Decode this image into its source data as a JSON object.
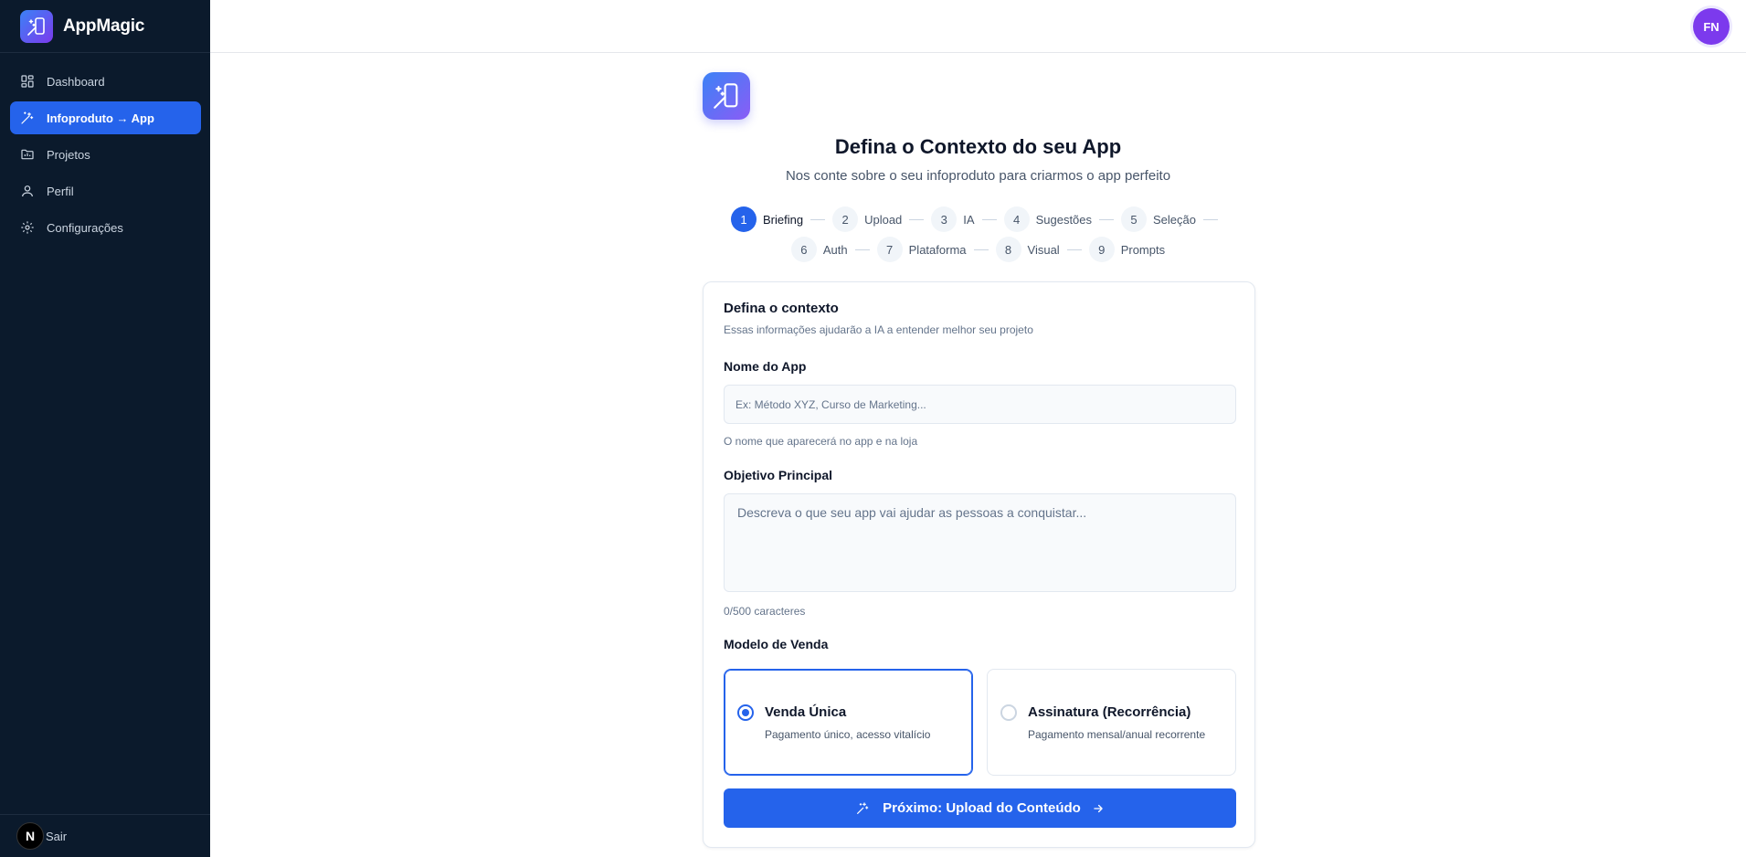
{
  "brand": {
    "name": "AppMagic",
    "logo_icon": "wand-phone-icon"
  },
  "sidebar": {
    "items": [
      {
        "label": "Dashboard",
        "icon": "grid-icon",
        "active": false
      },
      {
        "label": "Infoproduto → App",
        "icon": "wand-icon",
        "active": true
      },
      {
        "label": "Projetos",
        "icon": "folder-icon",
        "active": false
      },
      {
        "label": "Perfil",
        "icon": "user-icon",
        "active": false
      },
      {
        "label": "Configurações",
        "icon": "gear-icon",
        "active": false
      }
    ],
    "footer": {
      "badge": "N",
      "logout": "Sair"
    }
  },
  "header": {
    "avatar_initials": "FN"
  },
  "page": {
    "title": "Defina o Contexto do seu App",
    "subtitle": "Nos conte sobre o seu infoproduto para criarmos o app perfeito"
  },
  "steps": [
    {
      "num": "1",
      "label": "Briefing",
      "active": true
    },
    {
      "num": "2",
      "label": "Upload",
      "active": false
    },
    {
      "num": "3",
      "label": "IA",
      "active": false
    },
    {
      "num": "4",
      "label": "Sugestões",
      "active": false
    },
    {
      "num": "5",
      "label": "Seleção",
      "active": false
    },
    {
      "num": "6",
      "label": "Auth",
      "active": false
    },
    {
      "num": "7",
      "label": "Plataforma",
      "active": false
    },
    {
      "num": "8",
      "label": "Visual",
      "active": false
    },
    {
      "num": "9",
      "label": "Prompts",
      "active": false
    }
  ],
  "form": {
    "title": "Defina o contexto",
    "description": "Essas informações ajudarão a IA a entender melhor seu projeto",
    "app_name": {
      "label": "Nome do App",
      "value": "",
      "placeholder": "Ex: Método XYZ, Curso de Marketing...",
      "hint": "O nome que aparecerá no app e na loja"
    },
    "objective": {
      "label": "Objetivo Principal",
      "value": "",
      "placeholder": "Descreva o que seu app vai ajudar as pessoas a conquistar...",
      "counter": "0/500 caracteres"
    },
    "sales_model": {
      "label": "Modelo de Venda",
      "options": [
        {
          "title": "Venda Única",
          "description": "Pagamento único, acesso vitalício",
          "selected": true
        },
        {
          "title": "Assinatura (Recorrência)",
          "description": "Pagamento mensal/anual recorrente",
          "selected": false
        }
      ]
    },
    "next_button": "Próximo: Upload do Conteúdo"
  },
  "colors": {
    "primary": "#2563eb",
    "sidebar_bg": "#0b1a2c",
    "avatar": "#7c3aed"
  }
}
